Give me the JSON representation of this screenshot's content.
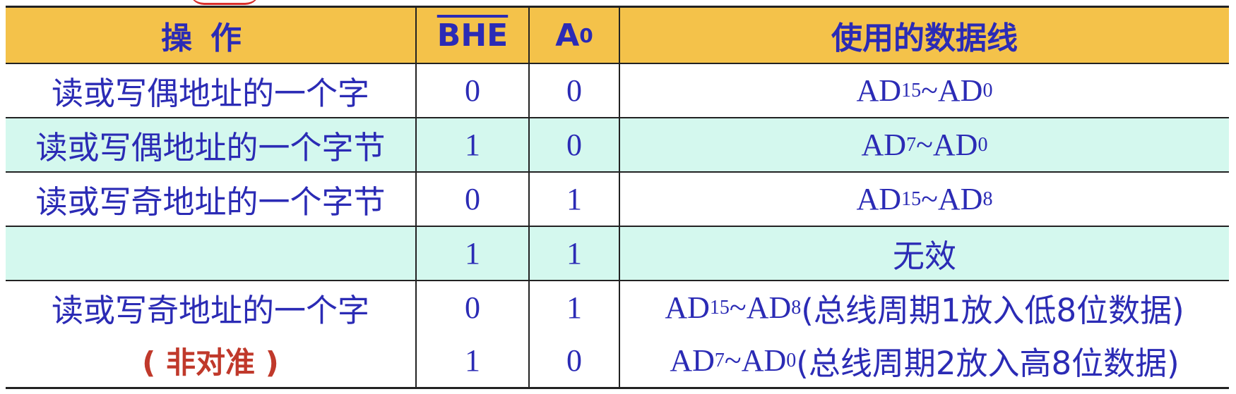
{
  "header": {
    "op": "操作",
    "bhe": "BHE",
    "a0_base": "A",
    "a0_sub": "0",
    "lines": "使用的数据线"
  },
  "rows": [
    {
      "op": "读或写偶地址的一个字",
      "bhe": "0",
      "a0": "0",
      "line_a": "AD",
      "line_a_sub": "15",
      "sep": "~",
      "line_b": "AD",
      "line_b_sub": "0",
      "teal": false
    },
    {
      "op": "读或写偶地址的一个字节",
      "bhe": "1",
      "a0": "0",
      "line_a": "AD",
      "line_a_sub": "7",
      "sep": "~",
      "line_b": "AD",
      "line_b_sub": "0",
      "teal": true
    },
    {
      "op": "读或写奇地址的一个字节",
      "bhe": "0",
      "a0": "1",
      "line_a": "AD",
      "line_a_sub": "15",
      "sep": "~",
      "line_b": "AD",
      "line_b_sub": "8",
      "teal": false
    },
    {
      "op": "",
      "bhe": "1",
      "a0": "1",
      "invalid": "无效",
      "teal": true
    }
  ],
  "last": {
    "op": "读或写奇地址的一个字",
    "op2": "( 非对准 )",
    "sub1": {
      "bhe": "0",
      "a0": "1",
      "line_a": "AD",
      "line_a_sub": "15",
      "sep": "~",
      "line_b": "AD",
      "line_b_sub": "8",
      "note": " (总线周期1放入低8位数据)"
    },
    "sub2": {
      "bhe": "1",
      "a0": "0",
      "line_a": "AD",
      "line_a_sub": "7",
      "sep": "~",
      "line_b": "AD",
      "line_b_sub": "0",
      "note": "(总线周期2放入高8位数据)"
    }
  }
}
